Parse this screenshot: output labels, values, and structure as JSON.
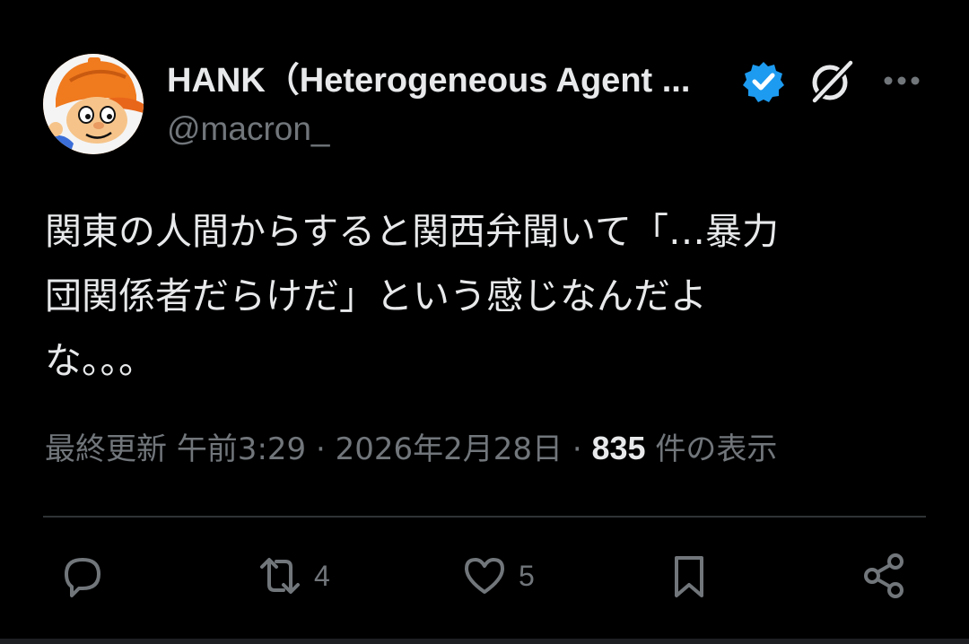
{
  "author": {
    "display_name": "HANK（Heterogeneous Agent ...",
    "handle": "@macron_",
    "verified": true,
    "avatar": "cartoon-character-orange-hat"
  },
  "header_icons": {
    "verified": "verified-badge-icon",
    "grok": "grok-icon",
    "more": "more-options-icon"
  },
  "tweet": {
    "lines": [
      "関東の人間からすると関西弁聞いて「…暴力",
      "団関係者だらけだ」という感じなんだよ",
      "な。。。"
    ]
  },
  "meta": {
    "updated_label": "最終更新",
    "time": "午前3:29",
    "separator": "·",
    "date": "2026年2月28日",
    "views_count": "835",
    "views_label": "件の表示"
  },
  "actions": {
    "reply": {
      "icon": "reply-icon",
      "count": ""
    },
    "retweet": {
      "icon": "retweet-icon",
      "count": "4"
    },
    "like": {
      "icon": "heart-icon",
      "count": "5"
    },
    "bookmark": {
      "icon": "bookmark-icon",
      "count": ""
    },
    "share": {
      "icon": "share-icon",
      "count": ""
    }
  },
  "colors": {
    "background": "#000000",
    "text": "#e7e9ea",
    "secondary": "#71767b",
    "verified_blue": "#1d9bf0",
    "divider": "#2f3336"
  }
}
